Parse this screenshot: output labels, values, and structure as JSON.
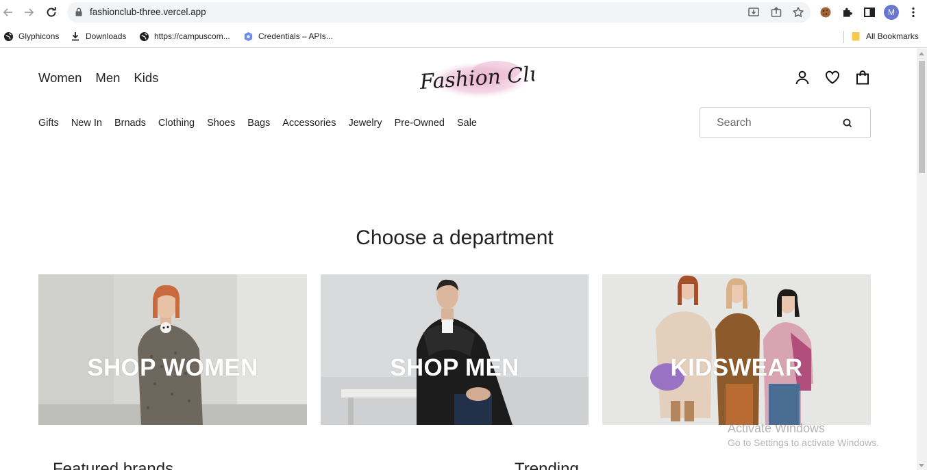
{
  "browser": {
    "url": "fashionclub-three.vercel.app",
    "avatar_letter": "M",
    "bookmarks": [
      {
        "label": "Glyphicons",
        "icon": "globe-icon"
      },
      {
        "label": "Downloads",
        "icon": "download-icon"
      },
      {
        "label": "https://campuscom...",
        "icon": "globe-icon"
      },
      {
        "label": "Credentials – APIs...",
        "icon": "api-icon"
      }
    ],
    "all_bookmarks_label": "All Bookmarks"
  },
  "header": {
    "departments": [
      "Women",
      "Men",
      "Kids"
    ],
    "logo_text": "Fashion Club",
    "categories": [
      "Gifts",
      "New In",
      "Brnads",
      "Clothing",
      "Shoes",
      "Bags",
      "Accessories",
      "Jewelry",
      "Pre-Owned",
      "Sale"
    ],
    "search_placeholder": "Search"
  },
  "main": {
    "section_title": "Choose a department",
    "cards": [
      {
        "label": "SHOP WOMEN"
      },
      {
        "label": "SHOP MEN"
      },
      {
        "label": "KIDSWEAR"
      }
    ],
    "featured_heading": "Featured brands",
    "trending_heading": "Trending"
  },
  "watermark": {
    "line1": "Activate Windows",
    "line2": "Go to Settings to activate Windows."
  },
  "colors": {
    "accent_avatar": "#6877cf",
    "logo_wash": "#e8b9d3",
    "text": "#222222"
  }
}
